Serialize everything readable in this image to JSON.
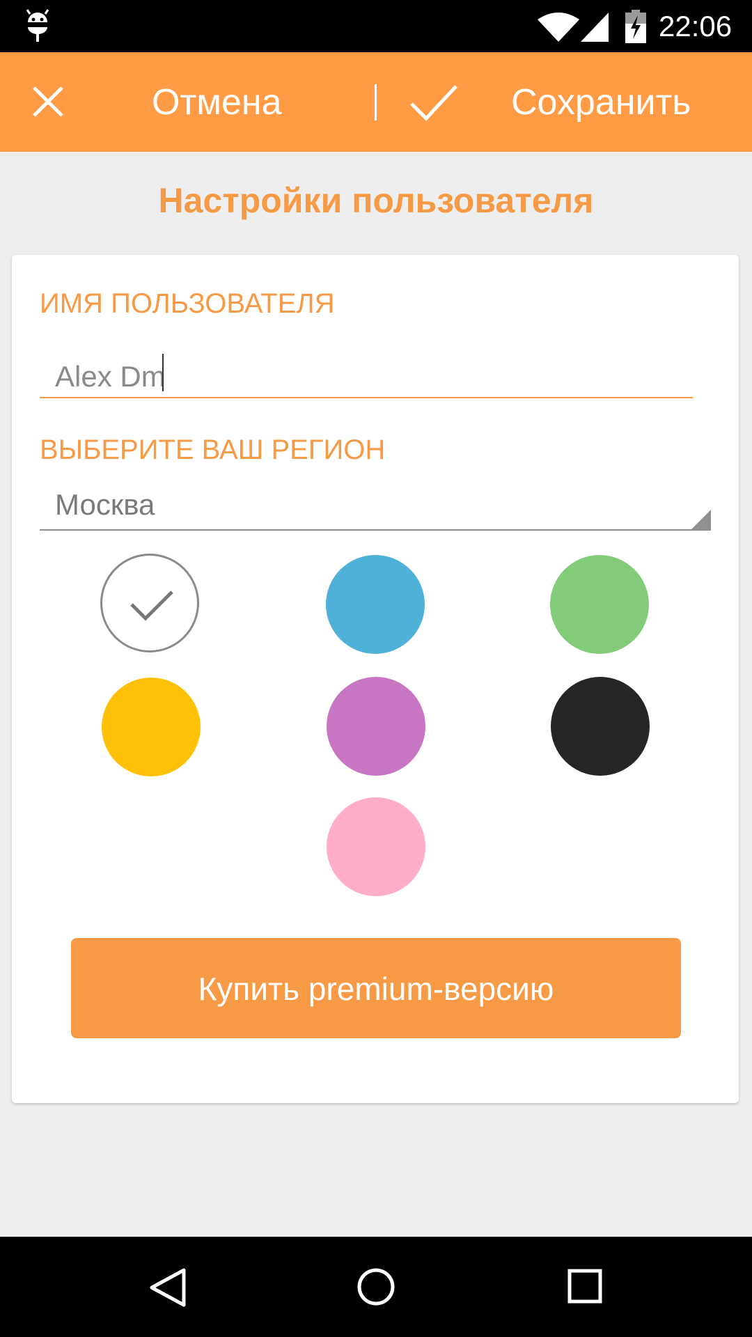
{
  "status_bar": {
    "time": "22:06",
    "icons": [
      "android-debug-icon",
      "wifi-icon",
      "signal-icon",
      "battery-charging-icon"
    ]
  },
  "action_bar": {
    "cancel_label": "Отмена",
    "save_label": "Сохранить",
    "cancel_icon": "close-icon",
    "save_icon": "check-icon",
    "background_color": "#ff9b45"
  },
  "page": {
    "title": "Настройки пользователя"
  },
  "form": {
    "username_label": "ИМЯ ПОЛЬЗОВАТЕЛЯ",
    "username_value": "Alex Dm",
    "region_label": "ВЫБЕРИТЕ ВАШ РЕГИОН",
    "region_value": "Москва"
  },
  "colors": {
    "selected": "white",
    "options": [
      {
        "name": "white",
        "hex": "#ffffff",
        "selected": true
      },
      {
        "name": "blue",
        "hex": "#4fb0d8",
        "selected": false
      },
      {
        "name": "green",
        "hex": "#82cb78",
        "selected": false
      },
      {
        "name": "yellow",
        "hex": "#ffc107",
        "selected": false
      },
      {
        "name": "purple",
        "hex": "#c876c3",
        "selected": false
      },
      {
        "name": "black",
        "hex": "#262626",
        "selected": false
      },
      {
        "name": "pink",
        "hex": "#ffadcb",
        "selected": false
      }
    ]
  },
  "premium_button": {
    "label": "Купить premium-версию"
  },
  "nav_bar": {
    "icons": [
      "back-icon",
      "home-icon",
      "recent-apps-icon"
    ]
  }
}
